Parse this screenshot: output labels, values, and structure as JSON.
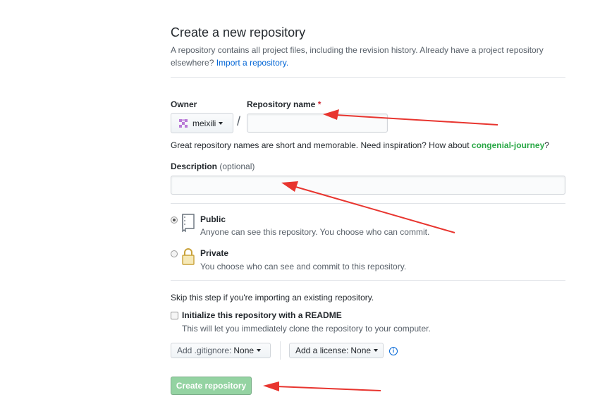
{
  "header": {
    "title": "Create a new repository",
    "desc_line1": "A repository contains all project files, including the revision history. Already have a project repository",
    "desc_line2_prefix": "elsewhere?",
    "import_link": "Import a repository."
  },
  "owner": {
    "label": "Owner",
    "value": "meixili"
  },
  "repo_name": {
    "label": "Repository name",
    "required_mark": "*",
    "value": ""
  },
  "separator": "/",
  "suggestion": {
    "text": "Great repository names are short and memorable. Need inspiration? How about",
    "name": "congenial-journey",
    "suffix": "?"
  },
  "description": {
    "label": "Description",
    "optional": "(optional)",
    "value": ""
  },
  "visibility": {
    "public": {
      "title": "Public",
      "desc": "Anyone can see this repository. You choose who can commit.",
      "selected": true
    },
    "private": {
      "title": "Private",
      "desc": "You choose who can see and commit to this repository.",
      "selected": false
    }
  },
  "init": {
    "skip_text": "Skip this step if you're importing an existing repository.",
    "readme_label": "Initialize this repository with a README",
    "readme_desc": "This will let you immediately clone the repository to your computer.",
    "readme_checked": false
  },
  "gitignore": {
    "prefix": "Add .gitignore:",
    "value": "None"
  },
  "license": {
    "prefix": "Add a license:",
    "value": "None"
  },
  "info_icon": "i",
  "submit": {
    "label": "Create repository",
    "disabled": true
  },
  "annotation_color": "#e8352f"
}
